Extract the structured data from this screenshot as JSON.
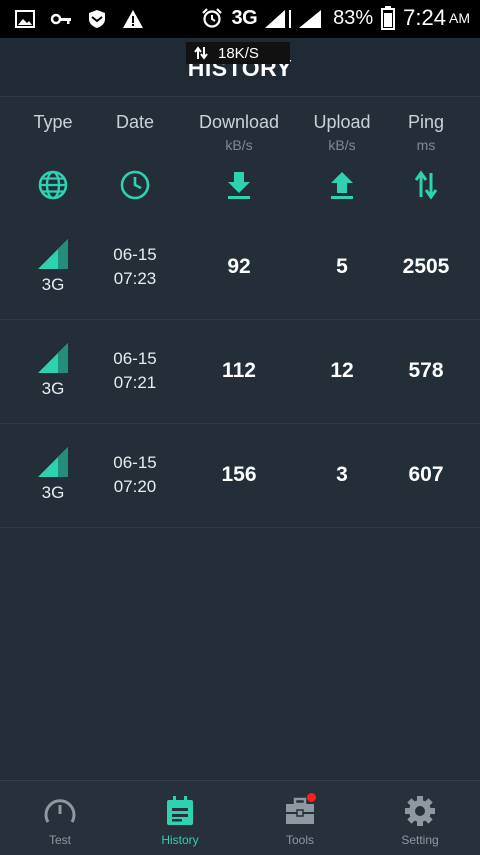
{
  "status_bar": {
    "network": "3G",
    "battery": "83%",
    "time": "7:24",
    "ampm": "AM"
  },
  "header": {
    "title": "HISTORY",
    "speed_indicator": "18K/S"
  },
  "columns": [
    {
      "label": "Type",
      "unit": "",
      "icon": "globe-icon"
    },
    {
      "label": "Date",
      "unit": "",
      "icon": "clock-icon"
    },
    {
      "label": "Download",
      "unit": "kB/s",
      "icon": "download-icon"
    },
    {
      "label": "Upload",
      "unit": "kB/s",
      "icon": "upload-icon"
    },
    {
      "label": "Ping",
      "unit": "ms",
      "icon": "ping-arrows-icon"
    }
  ],
  "rows": [
    {
      "type": "3G",
      "date": "06-15",
      "time": "07:23",
      "download": "92",
      "upload": "5",
      "ping": "2505"
    },
    {
      "type": "3G",
      "date": "06-15",
      "time": "07:21",
      "download": "112",
      "upload": "12",
      "ping": "578"
    },
    {
      "type": "3G",
      "date": "06-15",
      "time": "07:20",
      "download": "156",
      "upload": "3",
      "ping": "607"
    }
  ],
  "nav": [
    {
      "label": "Test",
      "icon": "speedometer-icon",
      "active": false
    },
    {
      "label": "History",
      "icon": "history-icon",
      "active": true
    },
    {
      "label": "Tools",
      "icon": "toolbox-icon",
      "active": false,
      "badge": true
    },
    {
      "label": "Setting",
      "icon": "gear-icon",
      "active": false
    }
  ],
  "colors": {
    "accent": "#2ed1b0",
    "background": "#232e39",
    "badge": "#ff1e1e"
  }
}
